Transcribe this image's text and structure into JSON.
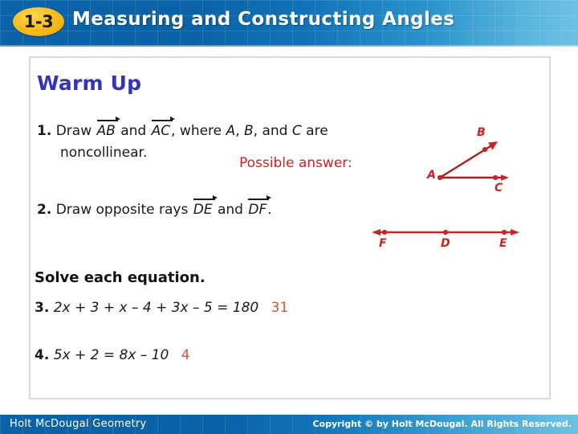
{
  "header": {
    "badge": "1-3",
    "title": "Measuring and Constructing Angles"
  },
  "content": {
    "section_title": "Warm Up",
    "questions": [
      {
        "number": "1.",
        "text_before": "Draw",
        "ray1": "AB",
        "conj": "and",
        "ray2": "AC",
        "text_after": ", where",
        "pointA": "A",
        "comma1": ",",
        "pointB": "B",
        "comma2": ", and",
        "pointC": "C",
        "text_end": "are",
        "line2": "noncollinear."
      },
      {
        "number": "2.",
        "text_before": "Draw opposite rays",
        "ray1": "DE",
        "conj": "and",
        "ray2": "DF",
        "text_after": "."
      }
    ],
    "possible_answer_label": "Possible answer:",
    "solve_heading": "Solve each equation.",
    "equations": [
      {
        "number": "3.",
        "equation": "2x + 3 + x – 4 + 3x – 5 = 180",
        "answer": "31"
      },
      {
        "number": "4.",
        "equation": "5x + 2 = 8x – 10",
        "answer": "4"
      }
    ]
  },
  "angle_figure": {
    "vertex_label": "A",
    "point_b_label": "B",
    "point_c_label": "C",
    "color": "#cc2222"
  },
  "line_figure": {
    "left_label": "F",
    "middle_label": "D",
    "right_label": "E",
    "color": "#cc2222"
  },
  "footer": {
    "left": "Holt McDougal Geometry",
    "right": "Copyright © by Holt McDougal. All Rights Reserved."
  },
  "colors": {
    "header_blue": "#0a63a8",
    "header_light_blue": "#6ec2e4",
    "badge_gold": "#fcbf1e",
    "warmup_blue": "#3333bb",
    "figure_red": "#cc2222",
    "answer_orange": "#e0532a"
  }
}
